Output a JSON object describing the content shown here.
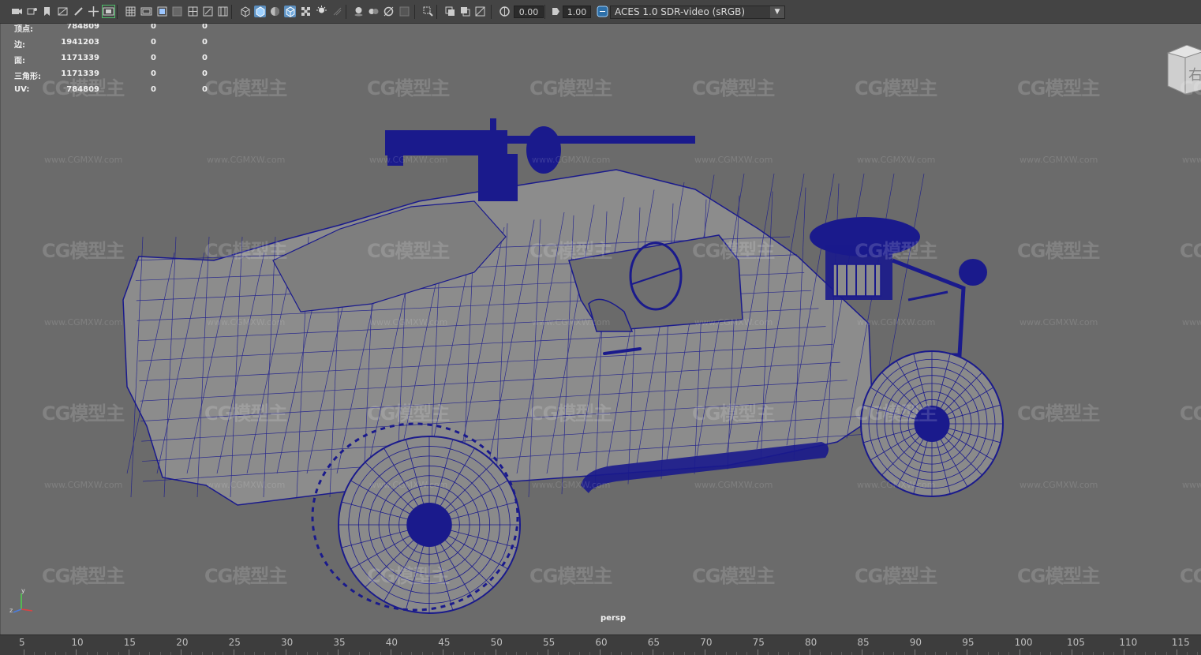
{
  "toolbar": {
    "exposure_value": "0.00",
    "gamma_value": "1.00",
    "color_space": "ACES 1.0 SDR-video (sRGB)",
    "icons": [
      "camera-icon",
      "camera-attributes-icon",
      "bookmark-icon",
      "image-plane-icon",
      "grease-pencil-icon",
      "two-d-pan-icon",
      "film-gate-icon",
      "grid-icon",
      "resolution-gate-icon",
      "safe-action-icon",
      "gate-mask-icon",
      "field-chart-icon",
      "wireframe-icon",
      "smooth-shade-icon",
      "default-material-icon",
      "wireframe-on-shaded-icon",
      "textured-icon",
      "lights-icon",
      "shadows-icon",
      "ambient-occlusion-icon",
      "motion-blur-icon",
      "antialiasing-icon",
      "isolate-select-icon",
      "xray-icon",
      "xray-joints-icon",
      "backface-icon",
      "exposure-icon",
      "gamma-icon",
      "color-management-icon"
    ],
    "accent": "#5c8fbf"
  },
  "hud": {
    "rows": [
      {
        "label": "顶点:",
        "v1": "784809",
        "v2": "0",
        "v3": "0"
      },
      {
        "label": "边:",
        "v1": "1941203",
        "v2": "0",
        "v3": "0"
      },
      {
        "label": "面:",
        "v1": "1171339",
        "v2": "0",
        "v3": "0"
      },
      {
        "label": "三角形:",
        "v1": "1171339",
        "v2": "0",
        "v3": "0"
      },
      {
        "label": "UV:",
        "v1": "784809",
        "v2": "0",
        "v3": "0"
      }
    ]
  },
  "viewport": {
    "camera_label": "persp",
    "watermark_text": "CG模型主",
    "watermark_url": "www.CGMXW.com",
    "viewcube_label": "右",
    "wire_color": "#1a1a8c"
  },
  "timeline": {
    "ticks": [
      "5",
      "10",
      "15",
      "20",
      "25",
      "30",
      "35",
      "40",
      "45",
      "50",
      "55",
      "60",
      "65",
      "70",
      "75",
      "80",
      "85",
      "90",
      "95",
      "100",
      "105",
      "110",
      "115"
    ]
  }
}
